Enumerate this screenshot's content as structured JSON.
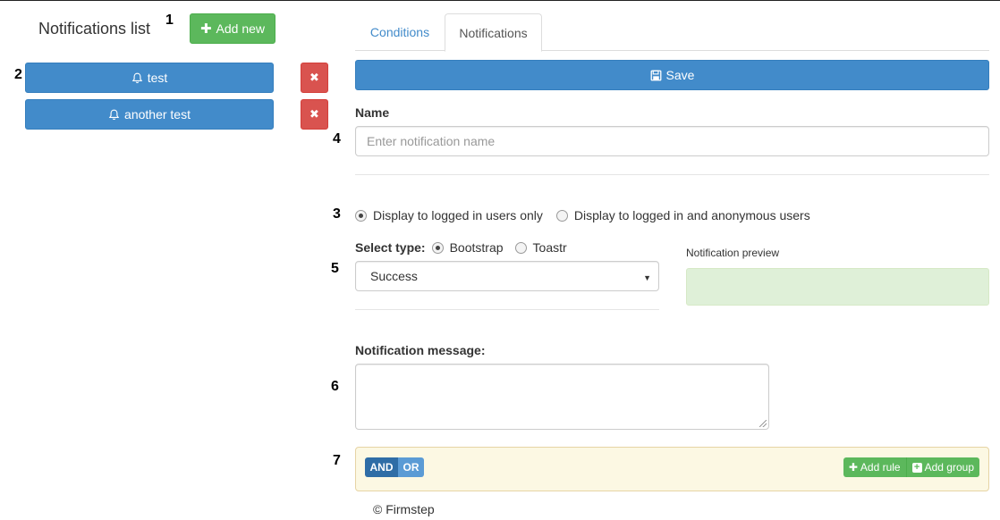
{
  "markers": {
    "m1": "1",
    "m2": "2",
    "m3": "3",
    "m4": "4",
    "m5": "5",
    "m6": "6",
    "m7": "7"
  },
  "left_panel": {
    "title": "Notifications list",
    "add_new_label": "Add new",
    "notifications": [
      {
        "label": "test",
        "icon": "bell-icon"
      },
      {
        "label": "another test",
        "icon": "bell-icon"
      }
    ],
    "delete_icon": "times-icon"
  },
  "tabs": [
    {
      "label": "Conditions",
      "active": false
    },
    {
      "label": "Notifications",
      "active": true
    }
  ],
  "form": {
    "save_label": "Save",
    "name_label": "Name",
    "name_placeholder": "Enter notification name",
    "name_value": "",
    "display_options": [
      {
        "label": "Display to logged in users only",
        "checked": true
      },
      {
        "label": "Display to logged in and anonymous users",
        "checked": false
      }
    ],
    "select_type_label": "Select type:",
    "type_options": [
      {
        "label": "Bootstrap",
        "checked": true
      },
      {
        "label": "Toastr",
        "checked": false
      }
    ],
    "style_select_value": "Success",
    "preview_label": "Notification preview",
    "message_label": "Notification message:",
    "message_value": ""
  },
  "query_builder": {
    "and_label": "AND",
    "or_label": "OR",
    "add_rule_label": "Add rule",
    "add_group_label": "Add group"
  },
  "footer": {
    "text": "© Firmstep"
  },
  "colors": {
    "primary": "#428bca",
    "success": "#5cb85c",
    "danger": "#d9534f",
    "preview_success_bg": "#dff0d8",
    "query_builder_bg": "#fcf8e3"
  }
}
